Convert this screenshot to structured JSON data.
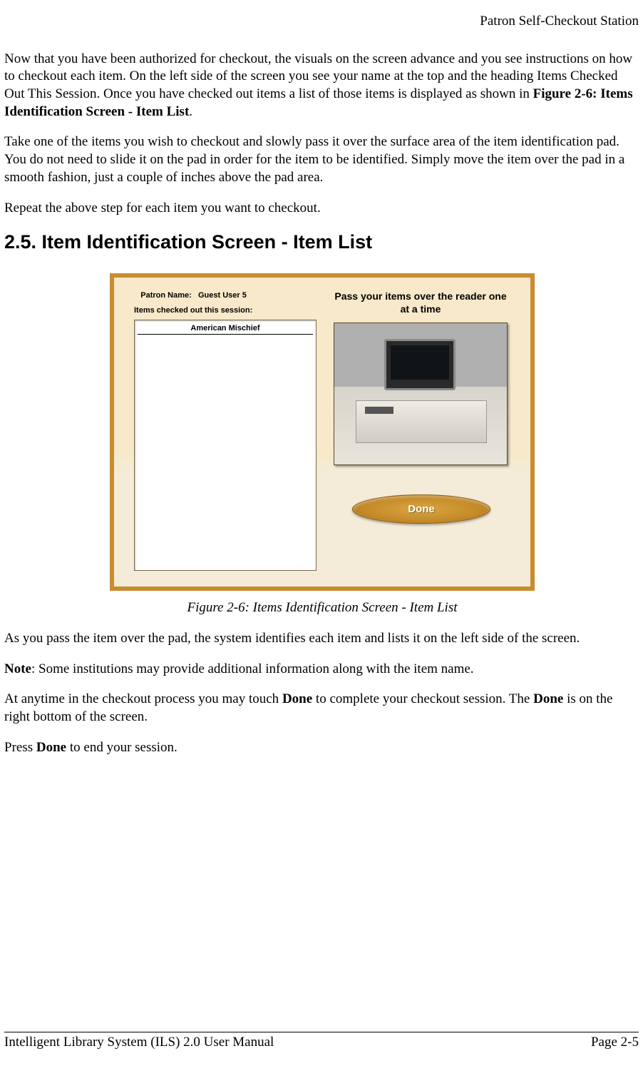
{
  "header": {
    "right": "Patron Self-Checkout Station"
  },
  "body": {
    "p1a": "Now that you have been authorized for checkout, the visuals on the screen advance and you see instructions on how to checkout each item. On the left side of the screen you see your name at the top and the heading Items Checked Out This Session. Once you have checked out items a list of those items is displayed as shown in ",
    "p1b_bold": "Figure 2-6: Items Identification Screen - Item List",
    "p1c": ".",
    "p2": "Take one of the items you wish to checkout and slowly pass it over the surface area of the item identification pad. You do not need to slide it on the pad in order for the item to be identified. Simply move the item over the pad in a smooth fashion, just a couple of inches above the pad area.",
    "p3": "Repeat the above step for each item you want to checkout.",
    "heading": "2.5.  Item Identification Screen - Item List",
    "p4": "As you pass the item over the pad, the system identifies each item and lists it on the left side of the screen.",
    "p5a_bold": "Note",
    "p5b": ": Some institutions may provide additional information along with the item name.",
    "p6a": "At anytime in the checkout process you may touch ",
    "p6b_bold": "Done",
    "p6c": " to complete your checkout session. The ",
    "p6d_bold": "Done",
    "p6e": " is on the right bottom of the screen.",
    "p7a": "Press ",
    "p7b_bold": "Done",
    "p7c": " to end your session."
  },
  "figure": {
    "patron_label": "Patron Name:",
    "patron_value": "Guest User 5",
    "session_label": "Items checked out this session:",
    "list_item_0": "American Mischief",
    "instruction": "Pass your items over the reader one at a time",
    "done_label": "Done",
    "caption": "Figure 2-6: Items Identification Screen - Item List"
  },
  "footer": {
    "left": "Intelligent Library System (ILS) 2.0 User Manual",
    "right": "Page 2-5"
  }
}
